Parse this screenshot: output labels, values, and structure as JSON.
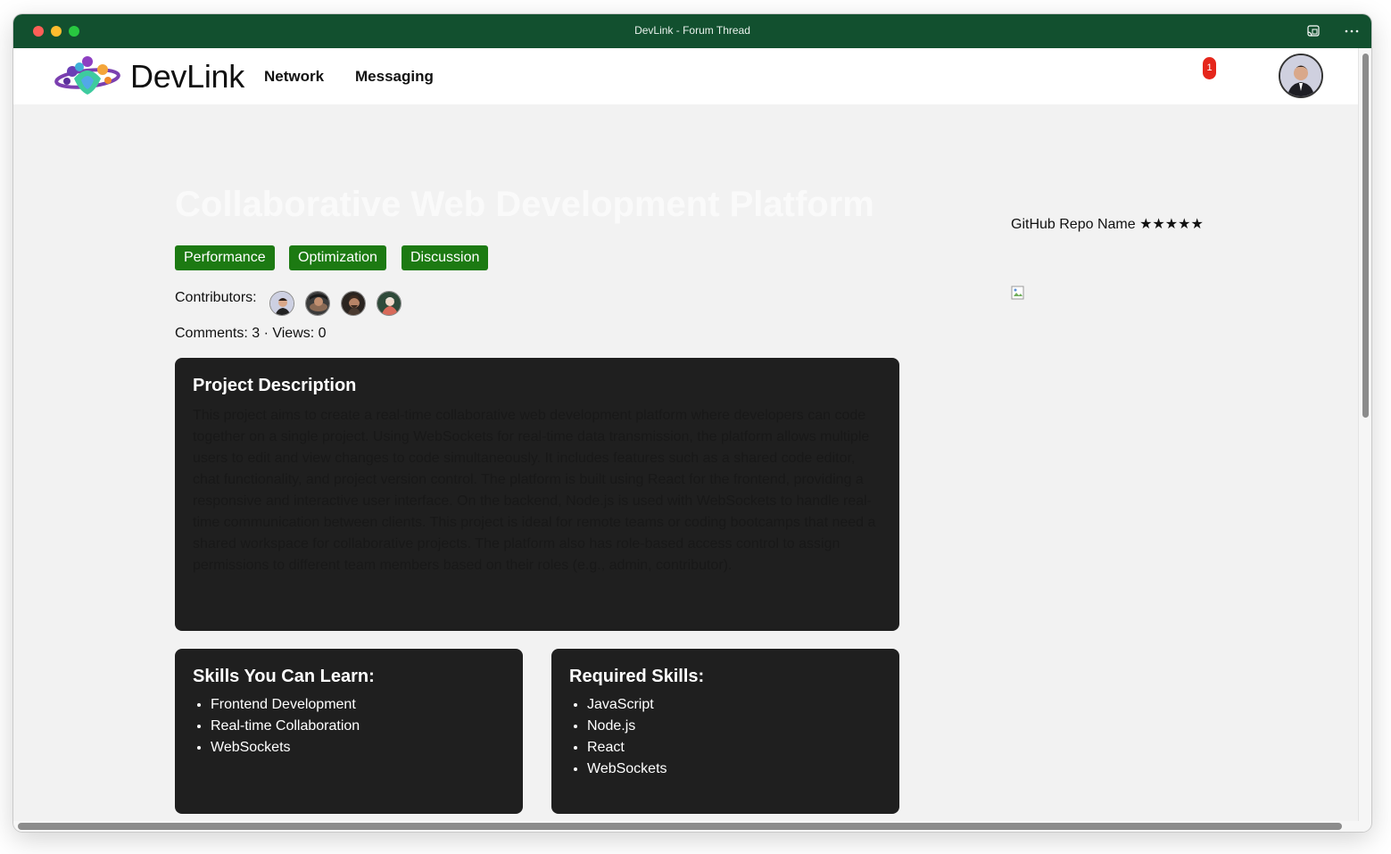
{
  "window": {
    "title": "DevLink - Forum Thread"
  },
  "navbar": {
    "brand": "DevLink",
    "links": [
      "Network",
      "Messaging"
    ],
    "notification_count": "1"
  },
  "post": {
    "title": "Collaborative Web Development Platform",
    "tags": [
      "Performance",
      "Optimization",
      "Discussion"
    ],
    "contributors_label": "Contributors:",
    "stats": "Comments: 3 · Views: 0",
    "description_heading": "Project Description",
    "description": "This project aims to create a real-time collaborative web development platform where developers can code together on a single project. Using WebSockets for real-time data transmission, the platform allows multiple users to edit and view changes to code simultaneously. It includes features such as a shared code editor, chat functionality, and project version control. The platform is built using React for the frontend, providing a responsive and interactive user interface. On the backend, Node.js is used with WebSockets to handle real-time communication between clients. This project is ideal for remote teams or coding bootcamps that need a shared workspace for collaborative projects. The platform also has role-based access control to assign permissions to different team members based on their roles (e.g., admin, contributor).",
    "learn_heading": "Skills You Can Learn:",
    "learn_skills": [
      "Frontend Development",
      "Real-time Collaboration",
      "WebSockets"
    ],
    "required_heading": "Required Skills:",
    "required_skills": [
      "JavaScript",
      "Node.js",
      "React",
      "WebSockets"
    ]
  },
  "sidebar": {
    "repo": "GitHub Repo Name ★★★★★"
  },
  "colors": {
    "titlebar": "#12502f",
    "tag": "#1c7a12",
    "card": "#1f1f1f",
    "notification": "#e5261b"
  }
}
